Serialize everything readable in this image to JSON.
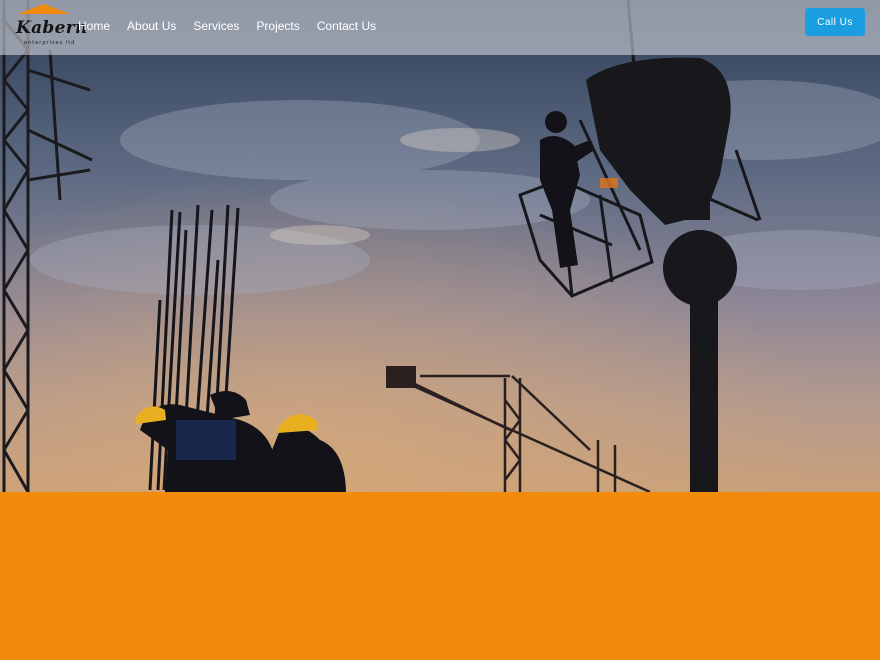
{
  "brand": {
    "name": "Kabern",
    "tagline": "enterprises ltd",
    "roof_color": "#f28a0c"
  },
  "nav": {
    "items": [
      {
        "label": "Home"
      },
      {
        "label": "About Us"
      },
      {
        "label": "Services"
      },
      {
        "label": "Projects"
      },
      {
        "label": "Contact Us"
      }
    ]
  },
  "cta": {
    "label": "Call Us",
    "color": "#1a9ee0"
  },
  "hero": {
    "image": "construction-site-sunset-photo",
    "accent_color": "#f28a0c"
  }
}
